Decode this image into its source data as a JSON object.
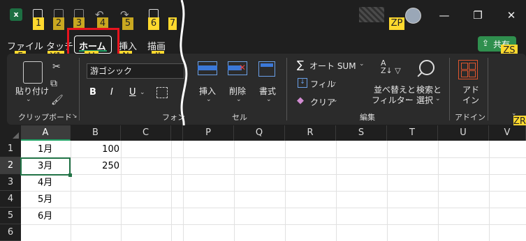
{
  "qat_keys": [
    "1",
    "2",
    "3",
    "4",
    "5",
    "6",
    "7"
  ],
  "account_key": "ZP",
  "tabs": [
    {
      "label": "ファイル",
      "key": "F"
    },
    {
      "label": "タッチ",
      "key": "Y1"
    },
    {
      "label": "ホーム",
      "key": "H"
    },
    {
      "label": "挿入",
      "key": "N"
    },
    {
      "label": "描画",
      "key": "JI"
    }
  ],
  "share": {
    "label": "共有",
    "key": "ZS"
  },
  "ribbon": {
    "clipboard": {
      "paste_label": "貼り付け",
      "group_label": "クリップボード"
    },
    "font": {
      "font_name": "游ゴシック",
      "bold": "B",
      "italic": "I",
      "underline": "U",
      "group_label": "フォン"
    },
    "cells": {
      "insert": "挿入",
      "delete": "削除",
      "format": "書式",
      "group_label": "セル"
    },
    "editing": {
      "autosum": "オート SUM",
      "fill": "フィル",
      "clear": "クリア",
      "sort_filter_1": "並べ替えと",
      "sort_filter_2": "フィルター",
      "find_select_1": "検索と",
      "find_select_2": "選択",
      "group_label": "編集"
    },
    "addins": {
      "label_1": "アド",
      "label_2": "イン",
      "group_label": "アドイン"
    },
    "collapse_key": "ZR"
  },
  "columns": [
    "A",
    "B",
    "C",
    "P",
    "Q",
    "R",
    "S",
    "T",
    "U",
    "V"
  ],
  "rows": [
    "1",
    "2",
    "3",
    "4",
    "5",
    "6"
  ],
  "cells": {
    "A1": "1月",
    "B1": "100",
    "A2": "3月",
    "B2": "250",
    "A3": "4月",
    "A4": "5月",
    "A5": "6月"
  },
  "colors": {
    "accent": "#217346",
    "highlight_box": "#e8141e",
    "keytip": "#ffd92e"
  }
}
